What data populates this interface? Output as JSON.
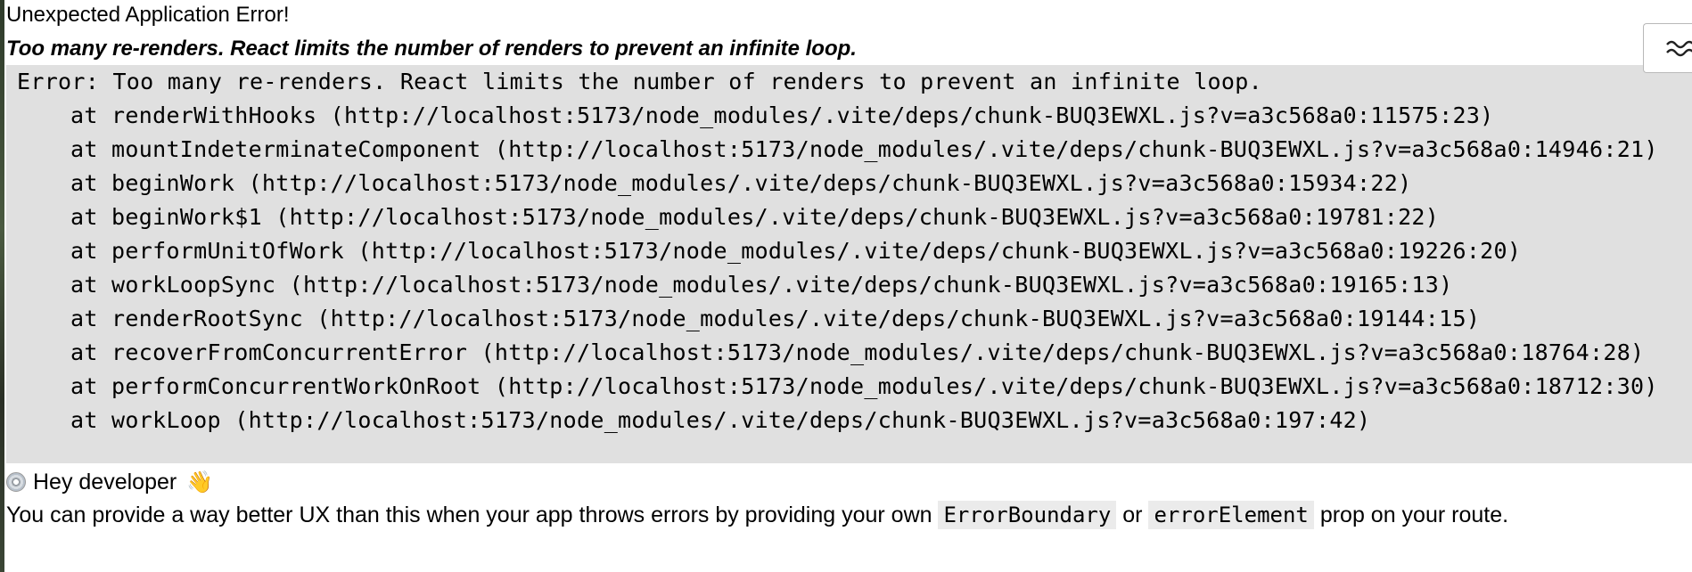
{
  "error_page": {
    "title": "Unexpected Application Error!",
    "message": "Too many re-renders. React limits the number of renders to prevent an infinite loop.",
    "stack_lines": [
      "Error: Too many re-renders. React limits the number of renders to prevent an infinite loop.",
      "at renderWithHooks (http://localhost:5173/node_modules/.vite/deps/chunk-BUQ3EWXL.js?v=a3c568a0:11575:23)",
      "at mountIndeterminateComponent (http://localhost:5173/node_modules/.vite/deps/chunk-BUQ3EWXL.js?v=a3c568a0:14946:21)",
      "at beginWork (http://localhost:5173/node_modules/.vite/deps/chunk-BUQ3EWXL.js?v=a3c568a0:15934:22)",
      "at beginWork$1 (http://localhost:5173/node_modules/.vite/deps/chunk-BUQ3EWXL.js?v=a3c568a0:19781:22)",
      "at performUnitOfWork (http://localhost:5173/node_modules/.vite/deps/chunk-BUQ3EWXL.js?v=a3c568a0:19226:20)",
      "at workLoopSync (http://localhost:5173/node_modules/.vite/deps/chunk-BUQ3EWXL.js?v=a3c568a0:19165:13)",
      "at renderRootSync (http://localhost:5173/node_modules/.vite/deps/chunk-BUQ3EWXL.js?v=a3c568a0:19144:15)",
      "at recoverFromConcurrentError (http://localhost:5173/node_modules/.vite/deps/chunk-BUQ3EWXL.js?v=a3c568a0:18764:28)",
      "at performConcurrentWorkOnRoot (http://localhost:5173/node_modules/.vite/deps/chunk-BUQ3EWXL.js?v=a3c568a0:18712:30)",
      "at workLoop (http://localhost:5173/node_modules/.vite/deps/chunk-BUQ3EWXL.js?v=a3c568a0:197:42)"
    ],
    "developer_heading": "Hey developer",
    "developer_icon": "disc-icon",
    "wave_emoji": "👋",
    "hint": {
      "before": "You can provide a way better UX than this when your app throws errors by providing your own",
      "code1": "ErrorBoundary",
      "middle": "or",
      "code2": "errorElement",
      "after": "prop on your route."
    }
  },
  "overlay_toggle": {
    "icon": "wave-lines-icon"
  },
  "colors": {
    "stack_background": "#e0e0e0",
    "code_background": "#ebebeb",
    "text": "#000000"
  }
}
